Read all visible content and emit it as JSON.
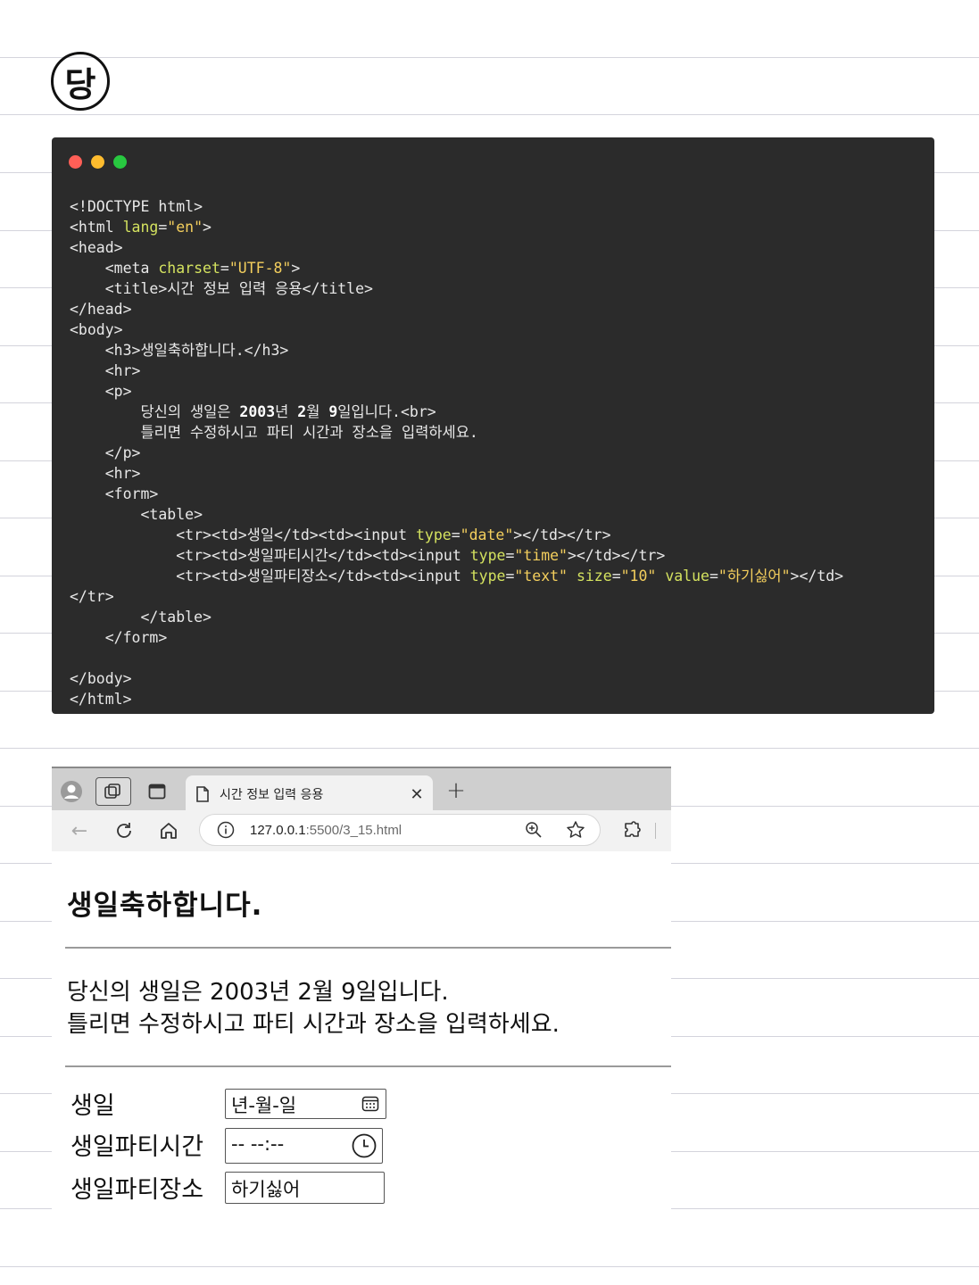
{
  "badge": {
    "glyph": "당"
  },
  "code_window": {
    "dot_colors": [
      "#ff5f57",
      "#febc2e",
      "#28c840"
    ],
    "lines": [
      [
        {
          "t": "<!DOCTYPE html>"
        }
      ],
      [
        {
          "t": "<html "
        },
        {
          "t": "lang",
          "c": "attr"
        },
        {
          "t": "="
        },
        {
          "t": "\"en\"",
          "c": "str"
        },
        {
          "t": ">"
        }
      ],
      [
        {
          "t": "<head>"
        }
      ],
      [
        {
          "t": "    <meta "
        },
        {
          "t": "charset",
          "c": "attr"
        },
        {
          "t": "="
        },
        {
          "t": "\"UTF-8\"",
          "c": "str"
        },
        {
          "t": ">"
        }
      ],
      [
        {
          "t": "    <title>시간 정보 입력 응용</title>"
        }
      ],
      [
        {
          "t": "</head>"
        }
      ],
      [
        {
          "t": "<body>"
        }
      ],
      [
        {
          "t": "    <h3>생일축하합니다.</h3>"
        }
      ],
      [
        {
          "t": "    <hr>"
        }
      ],
      [
        {
          "t": "    <p>"
        }
      ],
      [
        {
          "t": "        당신의 생일은 "
        },
        {
          "t": "2003",
          "c": "strong"
        },
        {
          "t": "년 "
        },
        {
          "t": "2",
          "c": "strong"
        },
        {
          "t": "월 "
        },
        {
          "t": "9",
          "c": "strong"
        },
        {
          "t": "일입니다.<br>"
        }
      ],
      [
        {
          "t": "        틀리면 수정하시고 파티 시간과 장소을 입력하세요."
        }
      ],
      [
        {
          "t": "    </p>"
        }
      ],
      [
        {
          "t": "    <hr>"
        }
      ],
      [
        {
          "t": "    <form>"
        }
      ],
      [
        {
          "t": "        <table>"
        }
      ],
      [
        {
          "t": "            <tr><td>생일</td><td><input "
        },
        {
          "t": "type",
          "c": "attr"
        },
        {
          "t": "="
        },
        {
          "t": "\"date\"",
          "c": "str"
        },
        {
          "t": "></td></tr>"
        }
      ],
      [
        {
          "t": "            <tr><td>생일파티시간</td><td><input "
        },
        {
          "t": "type",
          "c": "attr"
        },
        {
          "t": "="
        },
        {
          "t": "\"time\"",
          "c": "str"
        },
        {
          "t": "></td></tr>"
        }
      ],
      [
        {
          "t": "            <tr><td>생일파티장소</td><td><input "
        },
        {
          "t": "type",
          "c": "attr"
        },
        {
          "t": "="
        },
        {
          "t": "\"text\"",
          "c": "str"
        },
        {
          "t": " "
        },
        {
          "t": "size",
          "c": "attr"
        },
        {
          "t": "="
        },
        {
          "t": "\"10\"",
          "c": "str"
        },
        {
          "t": " "
        },
        {
          "t": "value",
          "c": "attr"
        },
        {
          "t": "="
        },
        {
          "t": "\"하기싫어\"",
          "c": "str"
        },
        {
          "t": "></td>"
        }
      ],
      [
        {
          "t": "</tr>"
        }
      ],
      [
        {
          "t": "        </table>"
        }
      ],
      [
        {
          "t": "    </form>"
        }
      ],
      [
        {
          "t": ""
        }
      ],
      [
        {
          "t": "</body>"
        }
      ],
      [
        {
          "t": "</html>"
        }
      ]
    ]
  },
  "browser": {
    "tab_title": "시간 정보 입력 응용",
    "url_host": "127.0.0.1",
    "url_path": ":5500/3_15.html",
    "icons": {
      "profile": "profile-icon",
      "workspaces": "workspaces-icon",
      "tab_actions": "tab-actions-icon",
      "page": "page-icon",
      "close": "close-icon",
      "new_tab": "new-tab-icon",
      "back": "back-icon",
      "refresh": "refresh-icon",
      "home": "home-icon",
      "info": "info-icon",
      "zoom": "zoom-icon",
      "favorite": "star-icon",
      "extensions": "extensions-icon"
    },
    "page": {
      "heading": "생일축하합니다.",
      "para_line1": "당신의 생일은 2003년 2월 9일입니다.",
      "para_line2": "틀리면 수정하시고 파티 시간과 장소을 입력하세요.",
      "form": {
        "date_label": "생일",
        "date_placeholder": "년-월-일",
        "time_label": "생일파티시간",
        "time_placeholder": "-- --:--",
        "place_label": "생일파티장소",
        "place_value": "하기싫어"
      }
    }
  }
}
